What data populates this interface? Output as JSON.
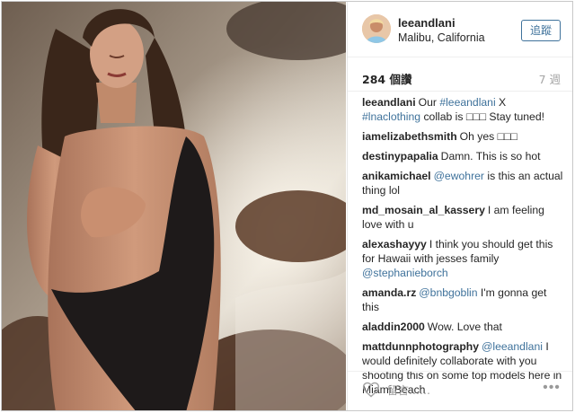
{
  "post": {
    "username": "leeandlani",
    "location": "Malibu, California",
    "follow_label": "追蹤",
    "views": "284 個讚",
    "age": "7 週"
  },
  "comments": [
    {
      "user": "leeandlani",
      "parts": [
        {
          "t": "Our "
        },
        {
          "t": "#leeandlani",
          "link": true
        },
        {
          "t": " X "
        },
        {
          "t": "#lnaclothing",
          "link": true
        },
        {
          "t": " collab is □□□ Stay tuned!"
        }
      ]
    },
    {
      "user": "iamelizabethsmith",
      "parts": [
        {
          "t": "Oh yes □□□"
        }
      ]
    },
    {
      "user": "destinypapalia",
      "parts": [
        {
          "t": "Damn. This is so hot"
        }
      ]
    },
    {
      "user": "anikamichael",
      "parts": [
        {
          "t": "@ewohrer",
          "link": true
        },
        {
          "t": " is this an actual thing lol"
        }
      ]
    },
    {
      "user": "md_mosain_al_kassery",
      "parts": [
        {
          "t": "I am feeling love with u"
        }
      ]
    },
    {
      "user": "alexashayyy",
      "parts": [
        {
          "t": "I think you should get this for Hawaii with jesses family "
        },
        {
          "t": "@stephanieborch",
          "link": true
        }
      ]
    },
    {
      "user": "amanda.rz",
      "parts": [
        {
          "t": "@bnbgoblin",
          "link": true
        },
        {
          "t": " I'm gonna get this"
        }
      ]
    },
    {
      "user": "aladdin2000",
      "parts": [
        {
          "t": "Wow. Love that"
        }
      ]
    },
    {
      "user": "mattdunnphotography",
      "parts": [
        {
          "t": "@leeandlani",
          "link": true
        },
        {
          "t": " I would definitely collaborate with you shooting this on some top models here in Miami Beach"
        }
      ]
    }
  ],
  "actions": {
    "comment_placeholder": "留言……",
    "like_icon": "heart-icon",
    "more_icon": "more-options-icon",
    "more_glyph": "•••"
  },
  "colors": {
    "link": "#3f729b",
    "text": "#262626",
    "muted": "#a5a5a5"
  }
}
